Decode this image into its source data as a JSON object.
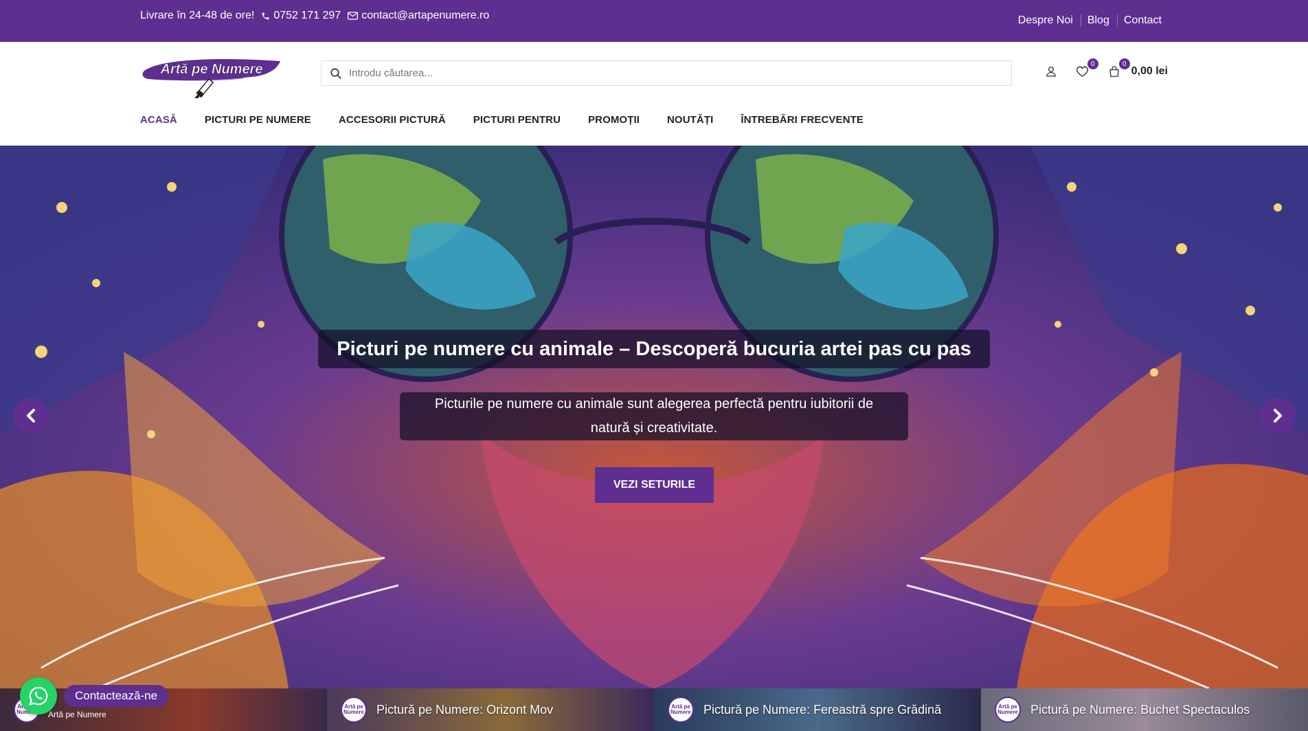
{
  "colors": {
    "brand": "#5f2e91",
    "whatsapp": "#25d366"
  },
  "topbar": {
    "delivery": "Livrare în 24-48 de ore!",
    "phone": "0752 171 297",
    "email": "contact@artapenumere.ro",
    "links": [
      "Despre Noi",
      "Blog",
      "Contact"
    ]
  },
  "header": {
    "logo_text": "Artă pe Numere",
    "search_placeholder": "Introdu căutarea...",
    "wishlist_count": "0",
    "cart_count": "0",
    "cart_total": "0,00 lei"
  },
  "nav": {
    "items": [
      "ACASĂ",
      "PICTURI PE NUMERE",
      "ACCESORII PICTURĂ",
      "PICTURI PENTRU",
      "PROMOȚII",
      "NOUTĂȚI",
      "ÎNTREBĂRI FRECVENTE"
    ]
  },
  "hero": {
    "title": "Picturi pe numere cu animale – Descoperă bucuria artei pas cu pas",
    "description": "Picturile pe numere cu animale sunt alegerea perfectă pentru iubitorii de natură și creativitate.",
    "button": "VEZI SETURILE"
  },
  "strip": {
    "items": [
      {
        "label": "",
        "brand": "Artă pe Numere"
      },
      {
        "label": "Pictură pe Numere: Orizont Mov"
      },
      {
        "label": "Pictură pe Numere: Fereastră spre Grădină"
      },
      {
        "label": "Pictură pe Numere: Buchet Spectaculos"
      }
    ],
    "avatar_text": "Artă pe Numere"
  },
  "whatsapp": {
    "label": "Contactează-ne"
  }
}
